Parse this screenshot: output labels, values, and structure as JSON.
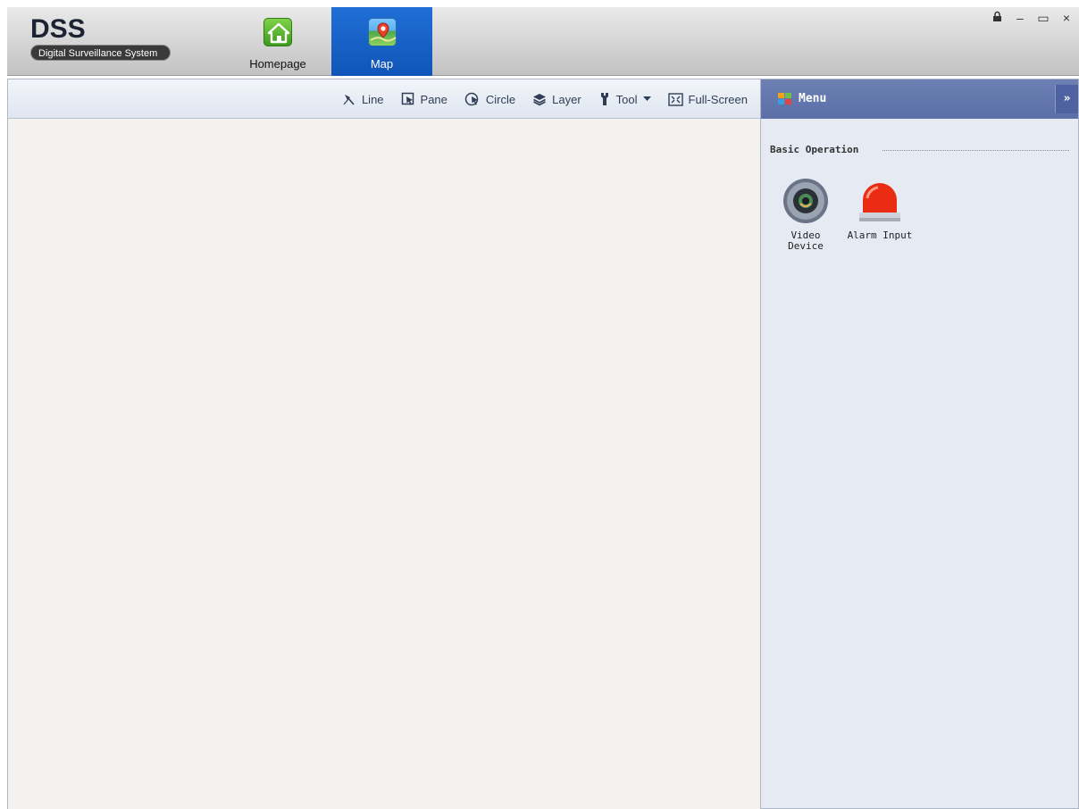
{
  "app": {
    "logo_title": "DSS",
    "logo_subtitle": "Digital Surveillance System"
  },
  "nav": {
    "tabs": [
      {
        "label": "Homepage",
        "icon": "home-icon",
        "active": false
      },
      {
        "label": "Map",
        "icon": "map-icon",
        "active": true
      }
    ]
  },
  "window_controls": {
    "lock": "lock-icon",
    "minimize": "–",
    "maximize": "▭",
    "close": "×"
  },
  "toolbar": {
    "line": "Line",
    "pane": "Pane",
    "circle": "Circle",
    "layer": "Layer",
    "tool": "Tool",
    "fullscreen": "Full-Screen"
  },
  "side_panel": {
    "title": "Menu",
    "collapse": "»",
    "section_title": "Basic Operation",
    "operations": [
      {
        "label": "Video\nDevice",
        "icon": "video-device-icon"
      },
      {
        "label": "Alarm Input",
        "icon": "alarm-light-icon"
      }
    ],
    "video_label_line1": "Video",
    "video_label_line2": "Device",
    "alarm_label": "Alarm Input"
  },
  "colors": {
    "active_tab": "#1a63cc",
    "panel_header": "#6476ad",
    "panel_bg": "#e6eaf3",
    "map_bg": "#f3f2ef"
  }
}
